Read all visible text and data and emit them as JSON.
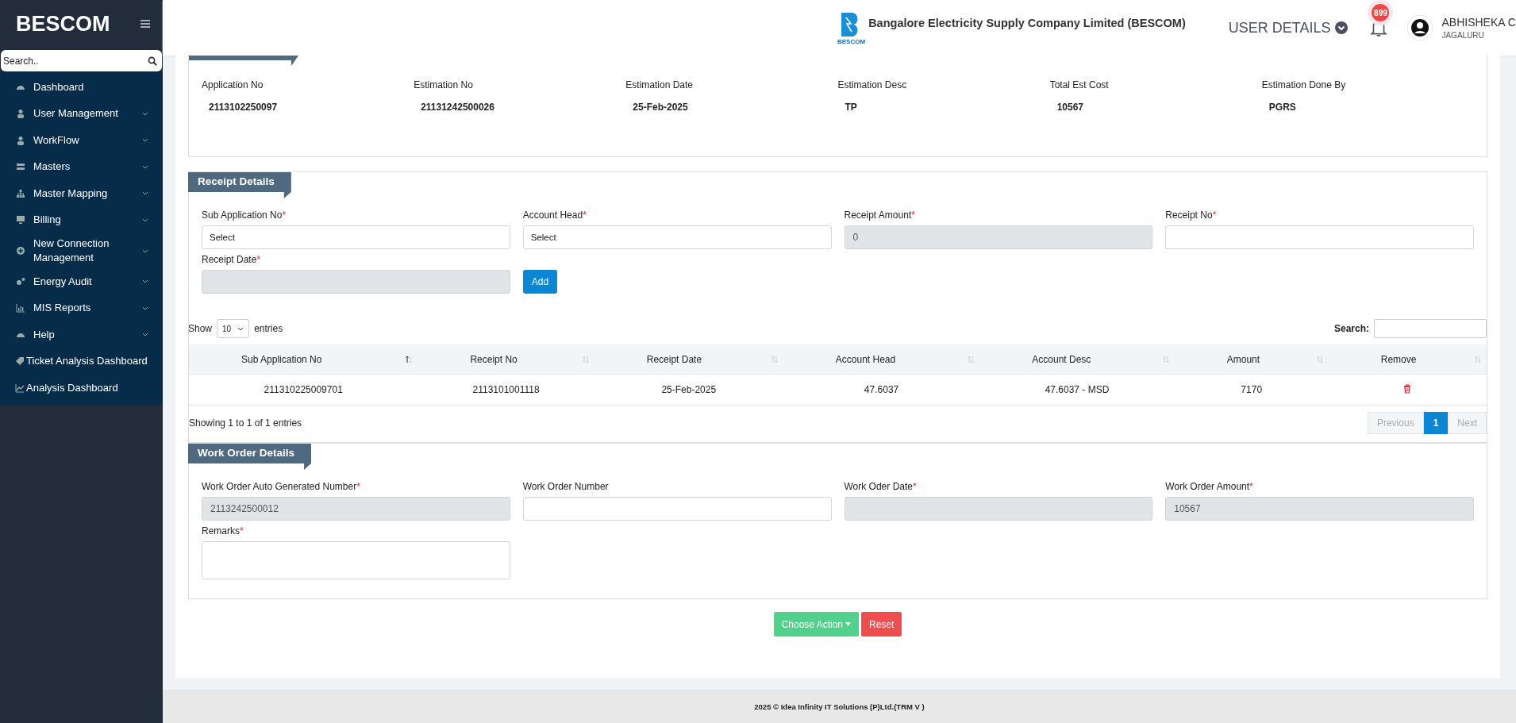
{
  "sidebar": {
    "brand": "BESCOM",
    "search": {
      "placeholder": "Search.."
    },
    "items": [
      {
        "label": "Dashboard",
        "expandable": false
      },
      {
        "label": "User Management",
        "expandable": true
      },
      {
        "label": "WorkFlow",
        "expandable": true
      },
      {
        "label": "Masters",
        "expandable": true
      },
      {
        "label": "Master Mapping",
        "expandable": true
      },
      {
        "label": "Billing",
        "expandable": true
      },
      {
        "label": "New Connection Management",
        "expandable": true
      },
      {
        "label": "Energy Audit",
        "expandable": true
      },
      {
        "label": "MIS Reports",
        "expandable": true
      },
      {
        "label": "Help",
        "expandable": true
      },
      {
        "label": "Ticket Analysis Dashboard",
        "expandable": false
      },
      {
        "label": "Analysis Dashboard",
        "expandable": false
      }
    ]
  },
  "header": {
    "logo_caption": "BESCOM",
    "company": "Bangalore Electricity Supply Company Limited (BESCOM)",
    "user_details": "USER DETAILS",
    "notifications": "899",
    "user_name": "ABHISHEKA C",
    "user_location": "JAGALURU"
  },
  "estimation": {
    "fields": [
      {
        "label": "Application No",
        "value": "2113102250097"
      },
      {
        "label": "Estimation No",
        "value": "21131242500026"
      },
      {
        "label": "Estimation Date",
        "value": "25-Feb-2025"
      },
      {
        "label": "Estimation Desc",
        "value": "TP"
      },
      {
        "label": "Total Est Cost",
        "value": "10567"
      },
      {
        "label": "Estimation Done By",
        "value": "PGRS"
      }
    ]
  },
  "receipt": {
    "title": "Receipt Details",
    "fields": [
      {
        "label": "Sub Application No",
        "mark": "*",
        "kind": "select",
        "value": "Select",
        "disabled": false
      },
      {
        "label": "Account Head",
        "mark": "*",
        "kind": "select",
        "value": "Select",
        "disabled": false
      },
      {
        "label": "Receipt Amount",
        "mark": "*",
        "kind": "text",
        "value": "0",
        "disabled": true
      },
      {
        "label": "Receipt No",
        "mark": "*",
        "kind": "text",
        "disabled": false
      },
      {
        "label": "Receipt Date",
        "mark": "*",
        "kind": "text",
        "disabled": true
      }
    ],
    "add_button": "Add",
    "table": {
      "show_label": "Show",
      "page_size": "10",
      "entries_label": "entries",
      "search_label": "Search:",
      "columns": [
        {
          "label": "Sub Application No",
          "sorted": true
        },
        {
          "label": "Receipt No",
          "sorted": false
        },
        {
          "label": "Receipt Date",
          "sorted": false
        },
        {
          "label": "Account Head",
          "sorted": false
        },
        {
          "label": "Account Desc",
          "sorted": false
        },
        {
          "label": "Amount",
          "sorted": false
        },
        {
          "label": "Remove",
          "sorted": false
        }
      ],
      "rows": [
        {
          "cells": [
            "211310225009701",
            "2113101001118",
            "25-Feb-2025",
            "47.6037",
            "47.6037 - MSD",
            "7170"
          ]
        }
      ],
      "info": "Showing 1 to 1 of 1 entries",
      "pagination": [
        {
          "label": "Previous",
          "selected": false,
          "disabled": true
        },
        {
          "label": "1",
          "selected": true,
          "disabled": false
        },
        {
          "label": "Next",
          "selected": false,
          "disabled": true
        }
      ]
    }
  },
  "work_order": {
    "title": "Work Order Details",
    "fields": [
      {
        "label": "Work Order Auto Generated Number",
        "mark": "*",
        "kind": "text",
        "value": "2113242500012",
        "disabled": true
      },
      {
        "label": "Work Order Number",
        "kind": "text",
        "disabled": false
      },
      {
        "label": "Work Oder Date",
        "mark": "*",
        "kind": "text",
        "disabled": true
      },
      {
        "label": "Work Order Amount",
        "mark": "*",
        "kind": "text",
        "value": "10567",
        "disabled": true
      },
      {
        "label": "Remarks",
        "mark": "*",
        "kind": "textarea",
        "disabled": false
      }
    ]
  },
  "actions": [
    {
      "label": "Choose Action",
      "kind": "dropdown"
    },
    {
      "label": "Reset",
      "kind": "reset"
    }
  ],
  "footer": "2025 © Idea Infinity IT Solutions (P)Ltd.(TRM V )"
}
